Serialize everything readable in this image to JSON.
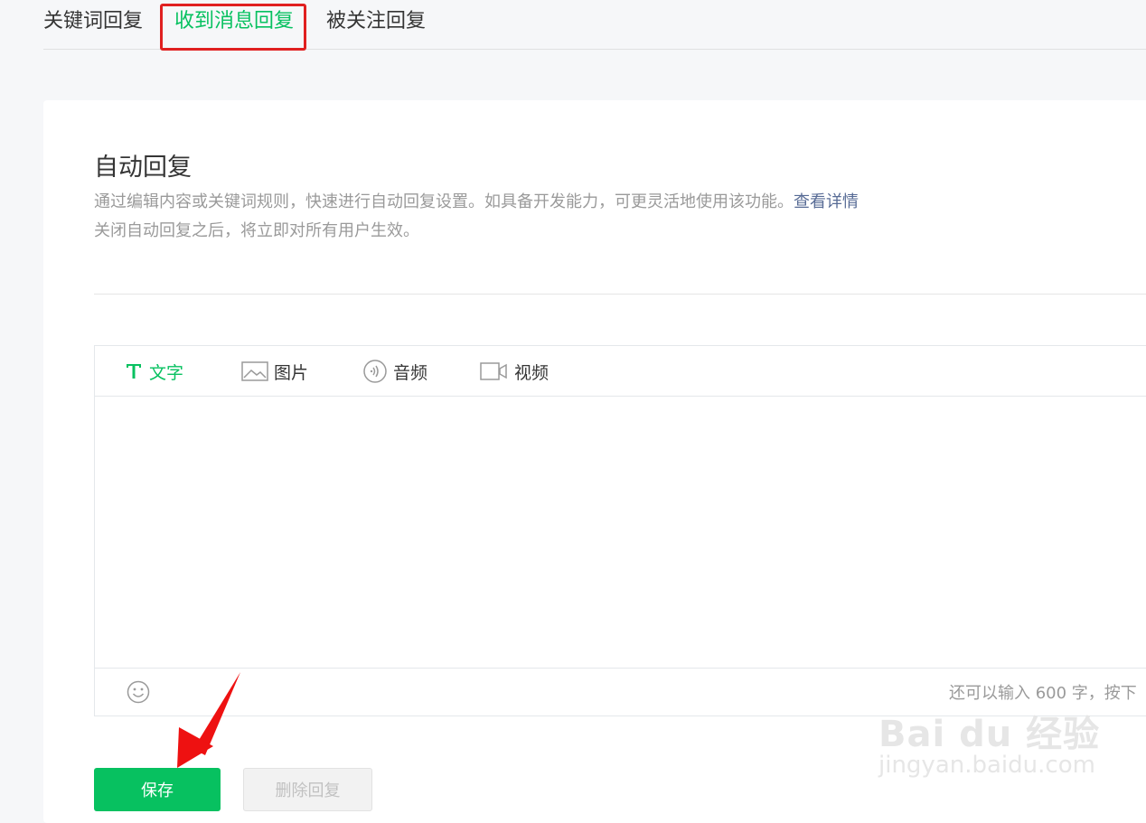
{
  "tabs": [
    {
      "label": "关键词回复",
      "active": false
    },
    {
      "label": "收到消息回复",
      "active": true
    },
    {
      "label": "被关注回复",
      "active": false
    }
  ],
  "main": {
    "title": "自动回复",
    "desc_line1": "通过编辑内容或关键词规则，快速进行自动回复设置。如具备开发能力，可更灵活地使用该功能。",
    "details_link": "查看详情",
    "desc_line2": "关闭自动回复之后，将立即对所有用户生效。"
  },
  "editor": {
    "tools": [
      {
        "label": "文字",
        "icon": "text-icon",
        "active": true
      },
      {
        "label": "图片",
        "icon": "image-icon",
        "active": false
      },
      {
        "label": "音频",
        "icon": "audio-icon",
        "active": false
      },
      {
        "label": "视频",
        "icon": "video-icon",
        "active": false
      }
    ],
    "emoji_icon": "emoji-icon",
    "counter_text": "还可以输入 600 字，按下"
  },
  "buttons": {
    "save": "保存",
    "delete": "删除回复"
  },
  "watermark": {
    "logo": "Bai du 经验",
    "url": "jingyan.baidu.com"
  },
  "colors": {
    "accent": "#07c160",
    "highlight": "#e02020",
    "link": "#576b95",
    "muted": "#9a9a9a"
  }
}
